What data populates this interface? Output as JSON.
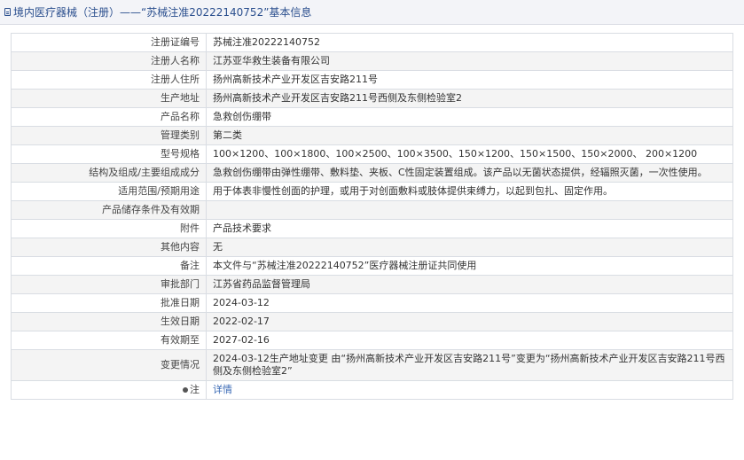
{
  "header": {
    "title": "境内医疗器械（注册）——“苏械注准20222140752”基本信息"
  },
  "rows": [
    {
      "label": "注册证编号",
      "value": "苏械注准20222140752"
    },
    {
      "label": "注册人名称",
      "value": "江苏亚华救生装备有限公司"
    },
    {
      "label": "注册人住所",
      "value": "扬州高新技术产业开发区吉安路211号"
    },
    {
      "label": "生产地址",
      "value": "扬州高新技术产业开发区吉安路211号西侧及东侧检验室2"
    },
    {
      "label": "产品名称",
      "value": "急救创伤绷带"
    },
    {
      "label": "管理类别",
      "value": "第二类"
    },
    {
      "label": "型号规格",
      "value": "100×1200、100×1800、100×2500、100×3500、150×1200、150×1500、150×2000、 200×1200"
    },
    {
      "label": "结构及组成/主要组成成分",
      "value": "急救创伤绷带由弹性绷带、敷料垫、夹板、C性固定装置组成。该产品以无菌状态提供，经辐照灭菌，一次性使用。"
    },
    {
      "label": "适用范围/预期用途",
      "value": "用于体表非慢性创面的护理，或用于对创面敷料或肢体提供束缚力，以起到包扎、固定作用。"
    },
    {
      "label": "产品储存条件及有效期",
      "value": ""
    },
    {
      "label": "附件",
      "value": "产品技术要求"
    },
    {
      "label": "其他内容",
      "value": "无"
    },
    {
      "label": "备注",
      "value": "本文件与“苏械注准20222140752”医疗器械注册证共同使用"
    },
    {
      "label": "审批部门",
      "value": "江苏省药品监督管理局"
    },
    {
      "label": "批准日期",
      "value": "2024-03-12"
    },
    {
      "label": "生效日期",
      "value": "2022-02-17"
    },
    {
      "label": "有效期至",
      "value": "2027-02-16"
    },
    {
      "label": "变更情况",
      "value": "2024-03-12生产地址变更 由“扬州高新技术产业开发区吉安路211号”变更为“扬州高新技术产业开发区吉安路211号西侧及东侧检验室2”"
    }
  ],
  "note": {
    "label": "注",
    "link": "详情"
  }
}
